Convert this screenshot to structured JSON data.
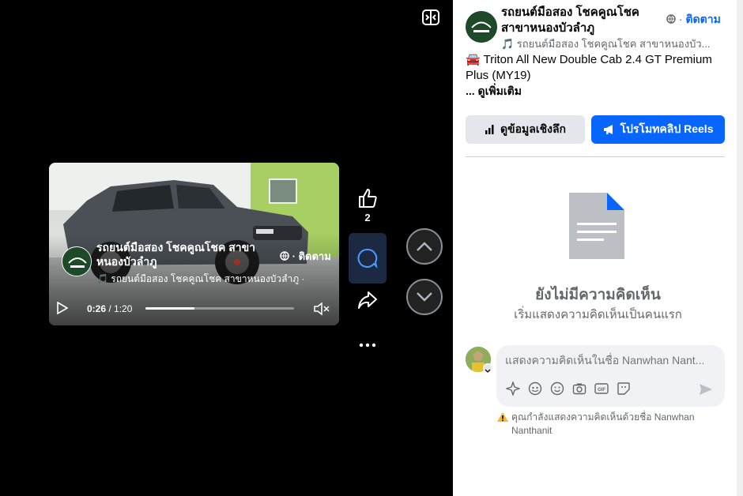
{
  "video": {
    "page_name": "รถยนต์มือสอง โชคคูณโชค สาขาหนองบัวลำภู",
    "follow": "· ติดตาม",
    "music": "🎵 รถยนต์มือสอง โชคคูณโชค สาขาหนองบัวลำภู · ",
    "time_current": "0:26",
    "time_total": "1:20",
    "progress": 0.33
  },
  "actions": {
    "like_count": "2"
  },
  "panel": {
    "page_name": "รถยนต์มือสอง โชคคูณโชค สาขาหนองบัวลำภู",
    "follow_sep": "· ",
    "follow_label": "ติดตาม",
    "music": "🎵 รถยนต์มือสอง โชคคูณโชค สาขาหนองบัว...",
    "description": "🚘  Triton All New Double Cab 2.4 GT Premium Plus (MY19)",
    "see_more": "... ดูเพิ่มเติม",
    "insight_button": "ดูข้อมูลเชิงลึก",
    "promote_button": "โปรโมทคลิป Reels",
    "empty_title": "ยังไม่มีความคิดเห็น",
    "empty_subtitle": "เริ่มแสดงความคิดเห็นเป็นคนแรก",
    "comment_placeholder": "แสดงความคิดเห็นในชื่อ Nanwhan Nant...",
    "warning": "คุณกำลังแสดงความคิดเห็นด้วยชื่อ Nanwhan Nanthanit"
  },
  "colors": {
    "accent": "#0866ff",
    "muted_text": "#65676b",
    "button_gray": "#e4e6eb",
    "comment_active_bg": "#1b2a42"
  }
}
